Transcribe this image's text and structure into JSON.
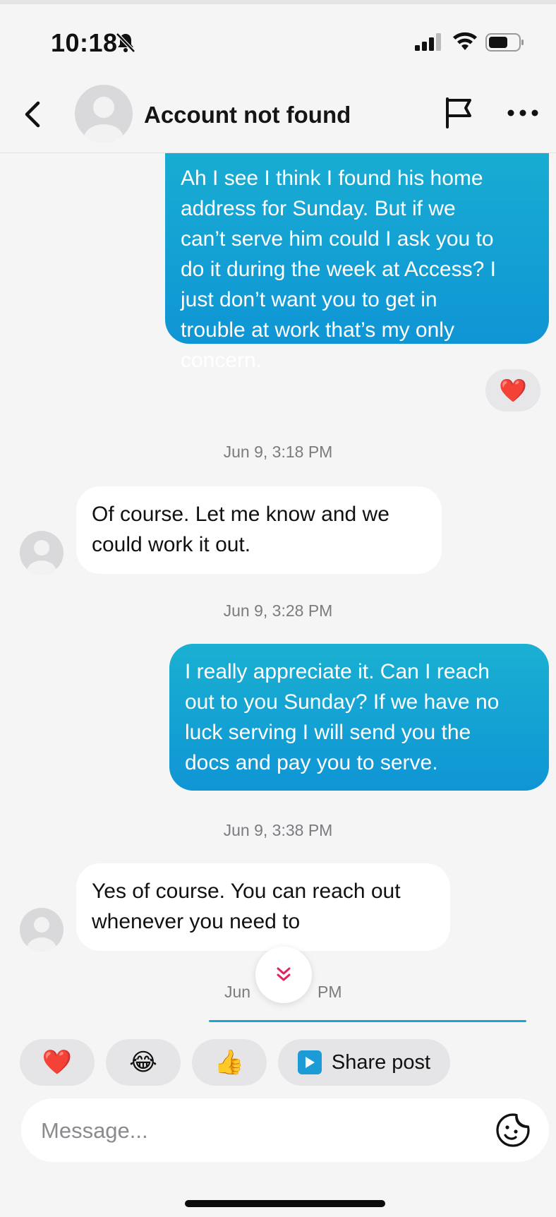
{
  "status_bar": {
    "time": "10:18",
    "icons": [
      "bell-slash-icon",
      "signal-icon",
      "wifi-icon",
      "battery-icon"
    ]
  },
  "header": {
    "title": "Account not found",
    "icons": [
      "back-chevron-icon",
      "profile-avatar-icon",
      "flag-icon",
      "more-icon"
    ]
  },
  "messages": [
    {
      "direction": "outgoing",
      "lines": [
        "Ah I see I think I found his home",
        "address for Sunday. But if we",
        "can’t serve him could I ask you to",
        "do it during the week at Access? I",
        "just don’t want you to get in",
        "trouble at work that’s my only",
        "concern."
      ],
      "reaction": "❤️"
    },
    {
      "timestamp": "Jun 9, 3:18 PM"
    },
    {
      "direction": "incoming",
      "lines": [
        "Of course. Let me know and we",
        "could work it out."
      ]
    },
    {
      "timestamp": "Jun 9, 3:28 PM"
    },
    {
      "direction": "outgoing",
      "lines": [
        "I really appreciate it. Can I reach",
        "out to you Sunday? If we have no",
        "luck serving I will send you the",
        "docs and pay you to serve."
      ]
    },
    {
      "timestamp": "Jun 9, 3:38 PM"
    },
    {
      "direction": "incoming",
      "lines": [
        "Yes of course. You can reach out",
        "whenever you need to"
      ]
    },
    {
      "timestamp_partial_left": "Jun",
      "timestamp_partial_right": "PM"
    }
  ],
  "quick_replies": [
    {
      "emoji": "❤️",
      "icon": "heart-icon"
    },
    {
      "emoji": "😂",
      "icon": "laughing-face-icon"
    },
    {
      "emoji": "👍",
      "icon": "thumbs-up-icon"
    },
    {
      "label": "Share post",
      "icon": "share-post-icon"
    }
  ],
  "composer": {
    "placeholder": "Message...",
    "icon": "sticker-icon"
  },
  "colors": {
    "outgoing_bubble": "#1ab0d2",
    "incoming_bubble": "#ffffff",
    "background": "#f5f5f6",
    "accent_red": "#e02335"
  }
}
